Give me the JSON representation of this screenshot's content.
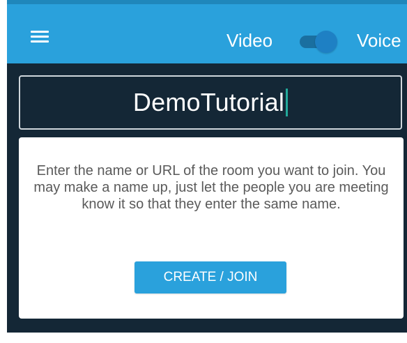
{
  "header": {
    "menu_icon": "hamburger-menu-icon",
    "video_label": "Video",
    "voice_label": "Voice",
    "toggle_state": "voice"
  },
  "room": {
    "value": "DemoTutorial"
  },
  "card": {
    "description": "Enter the name or URL of the room you want to join. You may make a name up, just let the people you are meeting know it so that they enter the same name.",
    "button_label": "CREATE / JOIN"
  },
  "colors": {
    "accent": "#2aa1dc",
    "background_dark": "#142736",
    "toggle": "#1e80c4",
    "caret": "#22a89a"
  }
}
